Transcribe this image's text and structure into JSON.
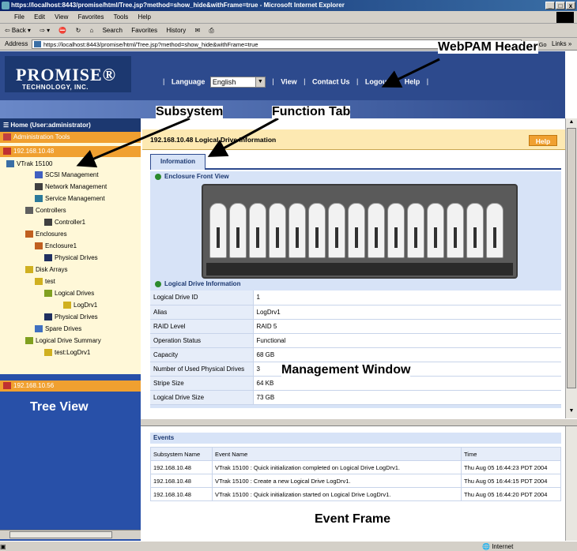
{
  "window": {
    "title": "https://localhost:8443/promise/html/Tree.jsp?method=show_hide&withFrame=true - Microsoft Internet Explorer",
    "controls": [
      "_",
      "□",
      "x"
    ]
  },
  "menu": [
    "File",
    "Edit",
    "View",
    "Favorites",
    "Tools",
    "Help"
  ],
  "toolbar": [
    "⇦ Back ▾",
    "⇨ ▾",
    "Search",
    "Favorites",
    "History"
  ],
  "address": {
    "label": "Address",
    "url": "https://localhost:8443/promise/html/Tree.jsp?method=show_hide&withFrame=true",
    "go": "→ Go",
    "links": "Links »"
  },
  "header": {
    "logo_main": "PROMISE®",
    "logo_sub": "TECHNOLOGY, INC.",
    "language_label": "Language",
    "language_value": "English",
    "nav": [
      "View",
      "Contact Us",
      "Logout",
      "Help"
    ]
  },
  "tree": {
    "home": "Home (User:administrator)",
    "items": [
      "Administration Tools",
      "192.168.10.48",
      "VTrak 15100",
      "SCSI Management",
      "Network Management",
      "Service Management",
      "Controllers",
      "Controller1",
      "Enclosures",
      "Enclosure1",
      "Physical Drives",
      "Disk Arrays",
      "test",
      "Logical Drives",
      "LogDrv1",
      "Physical Drives",
      "Spare Drives",
      "Logical Drive Summary",
      "test:LogDrv1"
    ],
    "subsystem2": "192.168.10.56"
  },
  "management": {
    "title": "192.168.10.48 Logical Drive Information",
    "help": "Help",
    "tab": "Information",
    "enclosure_title": "Enclosure Front View",
    "logical_title": "Logical Drive Information",
    "rows": [
      {
        "label": "Logical Drive ID",
        "value": "1"
      },
      {
        "label": "Alias",
        "value": "LogDrv1"
      },
      {
        "label": "RAID Level",
        "value": "RAID 5"
      },
      {
        "label": "Operation Status",
        "value": "Functional"
      },
      {
        "label": "Capacity",
        "value": "68 GB"
      },
      {
        "label": "Number of Used Physical Drives",
        "value": "3"
      },
      {
        "label": "Stripe Size",
        "value": "64 KB"
      },
      {
        "label": "Logical Drive Size",
        "value": "73 GB"
      }
    ]
  },
  "events": {
    "title": "Events",
    "headers": [
      "Subsystem Name",
      "Event Name",
      "Time"
    ],
    "rows": [
      [
        "192.168.10.48",
        "VTrak 15100 : Quick initialization completed on Logical Drive LogDrv1.",
        "Thu Aug 05 16:44:23 PDT 2004"
      ],
      [
        "192.168.10.48",
        "VTrak 15100 : Create a new Logical Drive LogDrv1.",
        "Thu Aug 05 16:44:15 PDT 2004"
      ],
      [
        "192.168.10.48",
        "VTrak 15100 : Quick initialization started on Logical Drive LogDrv1.",
        "Thu Aug 05 16:44:20 PDT 2004"
      ]
    ]
  },
  "status": {
    "zone": "Internet"
  },
  "annotations": {
    "webpam_header": "WebPAM Header",
    "subsystem": "Subsystem",
    "function_tab": "Function Tab",
    "management_window": "Management Window",
    "tree_view": "Tree View",
    "event_frame": "Event Frame"
  },
  "colors": {
    "header_blue": "#2d4a8d",
    "tree_blue": "#2850a8",
    "highlight_orange": "#f0a030",
    "panel_blue": "#d7e3f7"
  }
}
